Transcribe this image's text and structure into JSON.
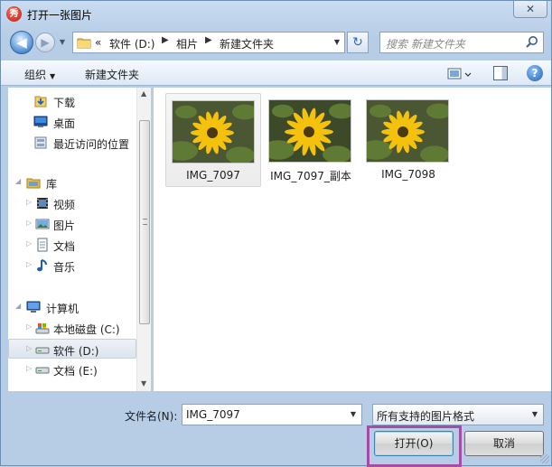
{
  "window": {
    "title": "打开一张图片",
    "app_icon_glyph": "秀",
    "close_glyph": "✕"
  },
  "navigation": {
    "back_glyph": "◀",
    "forward_glyph": "▶",
    "history_glyph": "▼",
    "breadcrumbs": [
      {
        "label": "«"
      },
      {
        "label": "软件 (D:)"
      },
      {
        "label": "相片"
      },
      {
        "label": "新建文件夹"
      }
    ],
    "crumb_separator": "▶",
    "dropdown_glyph": "▼",
    "refresh_glyph": "↻",
    "search_placeholder": "搜索 新建文件夹"
  },
  "toolbar": {
    "organize_label": "组织",
    "organize_arrow": "▼",
    "new_folder_label": "新建文件夹",
    "help_glyph": "?"
  },
  "nav_pane": {
    "items": [
      {
        "label": "下载",
        "icon": "download-folder-icon"
      },
      {
        "label": "桌面",
        "icon": "desktop-icon"
      },
      {
        "label": "最近访问的位置",
        "icon": "recent-places-icon"
      },
      {
        "label": "库",
        "icon": "libraries-icon"
      },
      {
        "label": "视频",
        "icon": "videos-icon"
      },
      {
        "label": "图片",
        "icon": "pictures-icon"
      },
      {
        "label": "文档",
        "icon": "documents-icon"
      },
      {
        "label": "音乐",
        "icon": "music-icon"
      },
      {
        "label": "计算机",
        "icon": "computer-icon"
      },
      {
        "label": "本地磁盘 (C:)",
        "icon": "system-drive-icon"
      },
      {
        "label": "软件 (D:)",
        "icon": "drive-icon",
        "selected": true
      },
      {
        "label": "文档 (E:)",
        "icon": "drive-icon"
      }
    ],
    "expander_glyph": "▷",
    "expanded_glyph": "◢"
  },
  "files": [
    {
      "name": "IMG_7097",
      "selected": true
    },
    {
      "name": "IMG_7097_副本",
      "selected": false
    },
    {
      "name": "IMG_7098",
      "selected": false
    }
  ],
  "footer": {
    "filename_label": "文件名(N):",
    "filename_value": "IMG_7097",
    "filetype_value": "所有支持的图片格式",
    "open_label": "打开(O)",
    "cancel_label": "取消",
    "dropdown_glyph": "▼"
  },
  "colors": {
    "selection_highlight": "#a64ca6",
    "petal": "#f4c20d",
    "flower_center": "#4a3a12"
  }
}
